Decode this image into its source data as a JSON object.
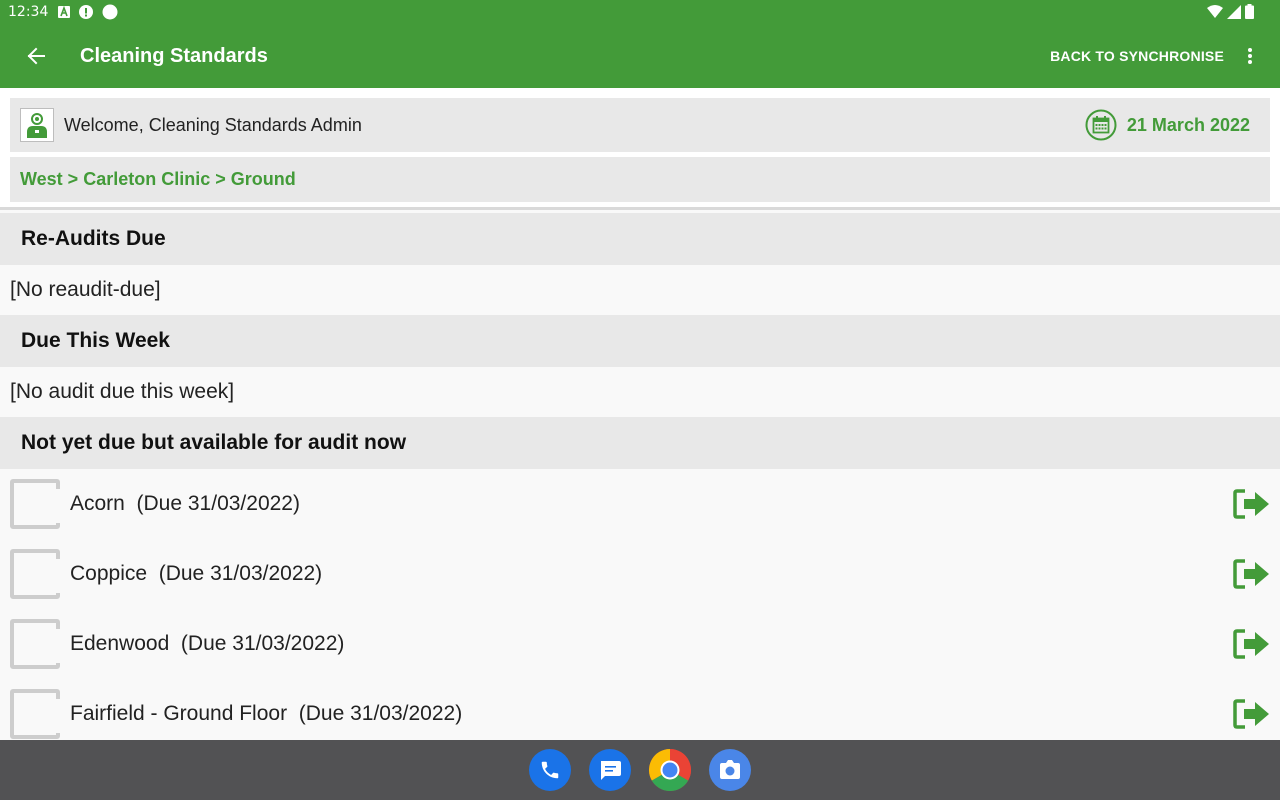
{
  "status_bar": {
    "time": "12:34",
    "left_icons": [
      "a-box-icon",
      "alert-icon",
      "circle-icon"
    ],
    "right_icons": [
      "wifi-icon",
      "signal-icon",
      "battery-icon"
    ]
  },
  "toolbar": {
    "title": "Cleaning Standards",
    "sync_label": "BACK TO SYNCHRONISE",
    "back_icon": "back-arrow-icon",
    "menu_icon": "overflow-menu-icon"
  },
  "header": {
    "welcome": "Welcome, Cleaning Standards Admin",
    "date": "21 March 2022",
    "breadcrumb": "West > Carleton Clinic > Ground"
  },
  "sections": {
    "reaudits": {
      "title": "Re-Audits Due",
      "empty": "[No reaudit-due]"
    },
    "due_week": {
      "title": "Due This Week",
      "empty": "[No audit due this week]"
    },
    "available": {
      "title": "Not yet due but available for audit now"
    }
  },
  "audits": [
    {
      "label": "Acorn  (Due 31/03/2022)",
      "checked": false
    },
    {
      "label": "Coppice  (Due 31/03/2022)",
      "checked": false
    },
    {
      "label": "Edenwood  (Due 31/03/2022)",
      "checked": false
    },
    {
      "label": "Fairfield - Ground Floor  (Due 31/03/2022)",
      "checked": false
    }
  ],
  "dock": [
    "phone-icon",
    "messages-icon",
    "chrome-icon",
    "camera-icon"
  ],
  "colors": {
    "primary": "#439b39",
    "header_bg": "#e8e8e8",
    "nav_bg": "#525254"
  }
}
